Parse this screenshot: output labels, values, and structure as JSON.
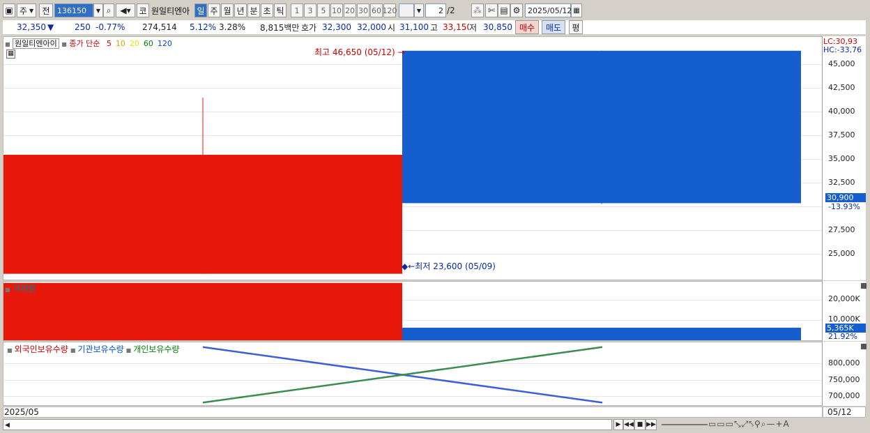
{
  "toolbar": {
    "market": "주",
    "scope": "전",
    "code": "136150",
    "type_char": "코",
    "stock_name": "원일티엔아",
    "periods": [
      "일",
      "주",
      "월",
      "년",
      "분",
      "초",
      "틱"
    ],
    "intervals": [
      "1",
      "3",
      "5",
      "10",
      "20",
      "30",
      "60",
      "120"
    ],
    "page": "2",
    "page_total": "/2",
    "date": "2025/05/12"
  },
  "quote": {
    "price": "32,350",
    "change": "250",
    "change_pct": "-0.77%",
    "volume": "274,514",
    "rate1": "5.12%",
    "rate2": "3.28%",
    "amount": "8,815백만",
    "ask_label": "호가",
    "ask": "32,300",
    "bid": "32,000",
    "open_label": "시",
    "open": "31,100",
    "high_label": "고",
    "high": "33,150",
    "low_label": "저",
    "low": "30,850",
    "buy_label": "매수",
    "sell_label": "매도",
    "eval_label": "평"
  },
  "price_panel": {
    "stock_tag": "원일티엔아이",
    "ma_label": "종가 단순",
    "ma_periods": [
      {
        "p": "5",
        "color": "#c80000"
      },
      {
        "p": "10",
        "color": "#e6a000"
      },
      {
        "p": "20",
        "color": "#e6e600"
      },
      {
        "p": "60",
        "color": "#008000"
      },
      {
        "p": "120",
        "color": "#0050c8"
      }
    ],
    "high_note": "최고 46,650 (05/12)",
    "low_note": "최저 23,600 (05/09)",
    "lc": "LC:30,93",
    "hc": "HC:-33,76",
    "ticks": [
      "45,000",
      "42,500",
      "40,000",
      "37,500",
      "35,000",
      "32,500",
      "27,500",
      "25,000"
    ],
    "current": "30,900",
    "current_pct": "-13.93%"
  },
  "volume_panel": {
    "title": "거래량",
    "ticks": [
      "20,000K",
      "10,000K"
    ],
    "current": "5,365K",
    "current_pct": "21.92%"
  },
  "holding_panel": {
    "legends": [
      {
        "label": "외국인보유수량",
        "color": "#c80000"
      },
      {
        "label": "기관보유수량",
        "color": "#0050c8"
      },
      {
        "label": "개인보유수량",
        "color": "#008000"
      }
    ],
    "ticks": [
      "800,000",
      "750,000",
      "700,000"
    ]
  },
  "xaxis": {
    "left": "2025/05",
    "right": "05/12"
  },
  "colors": {
    "up": "#e8190a",
    "down": "#155ecf",
    "individual": "#3a8c4f",
    "institution": "#3b5fd6"
  },
  "chart_data": [
    {
      "type": "candlestick",
      "x": [
        "05/09",
        "05/12"
      ],
      "series": [
        {
          "open": 23600,
          "high": 41800,
          "low": 23600,
          "close": 35900
        },
        {
          "open": 46650,
          "high": 46650,
          "low": 30800,
          "close": 30900
        }
      ],
      "ylim": [
        23000,
        47500
      ]
    },
    {
      "type": "bar",
      "title": "거래량",
      "x": [
        "05/09",
        "05/12"
      ],
      "values": [
        24500,
        5365
      ],
      "ylim": [
        0,
        25000
      ]
    },
    {
      "type": "line",
      "x": [
        "05/09",
        "05/12"
      ],
      "series": [
        {
          "name": "기관보유수량",
          "values": [
            835000,
            658000
          ]
        },
        {
          "name": "개인보유수량",
          "values": [
            658000,
            835000
          ]
        }
      ],
      "ylim": [
        650000,
        850000
      ]
    }
  ]
}
